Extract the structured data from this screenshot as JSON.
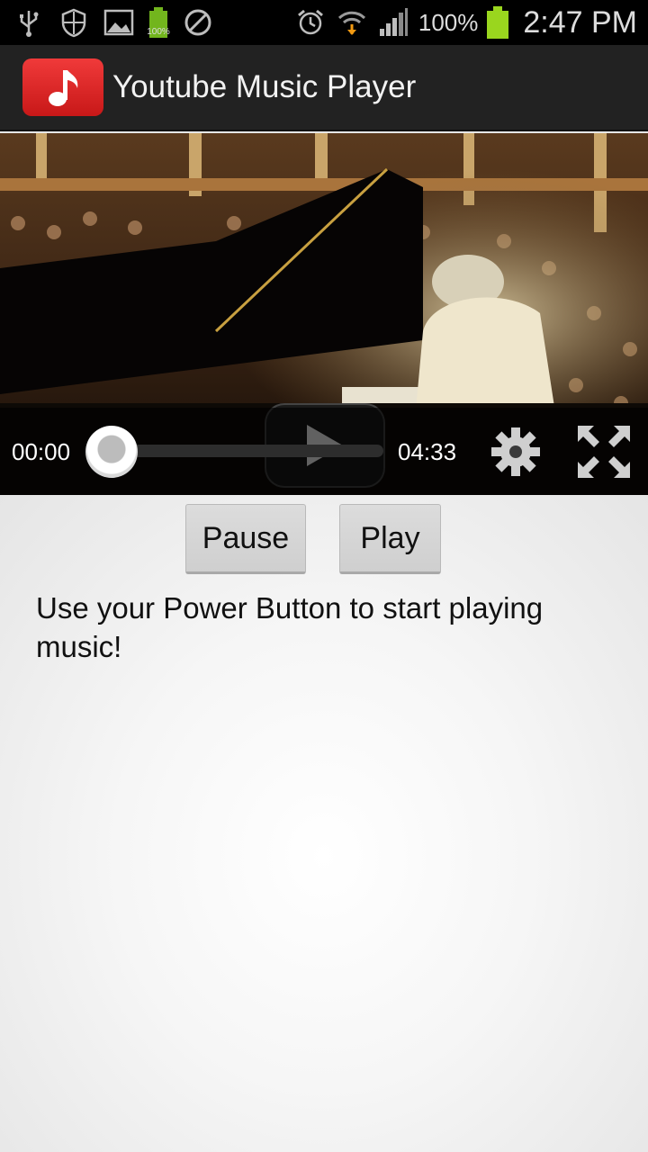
{
  "status_bar": {
    "icons": [
      "usb-icon",
      "shield-icon",
      "image-icon",
      "battery-charging-icon",
      "blocked-icon",
      "alarm-icon",
      "wifi-icon",
      "signal-icon",
      "battery-icon"
    ],
    "small_battery_label": "100%",
    "battery_percent": "100%",
    "time": "2:47 PM"
  },
  "action_bar": {
    "title": "Youtube Music Player",
    "icon": "music-note-icon"
  },
  "player": {
    "current_time": "00:00",
    "total_time": "04:33",
    "progress": 0.0
  },
  "buttons": {
    "pause_label": "Pause",
    "play_label": "Play"
  },
  "message": "Use your Power Button to start playing music!",
  "colors": {
    "status_bg": "#000000",
    "action_bar_bg": "#222222",
    "battery_green": "#9ad61e",
    "app_icon_red": "#e02626",
    "content_bg": "#f4f4f4"
  }
}
